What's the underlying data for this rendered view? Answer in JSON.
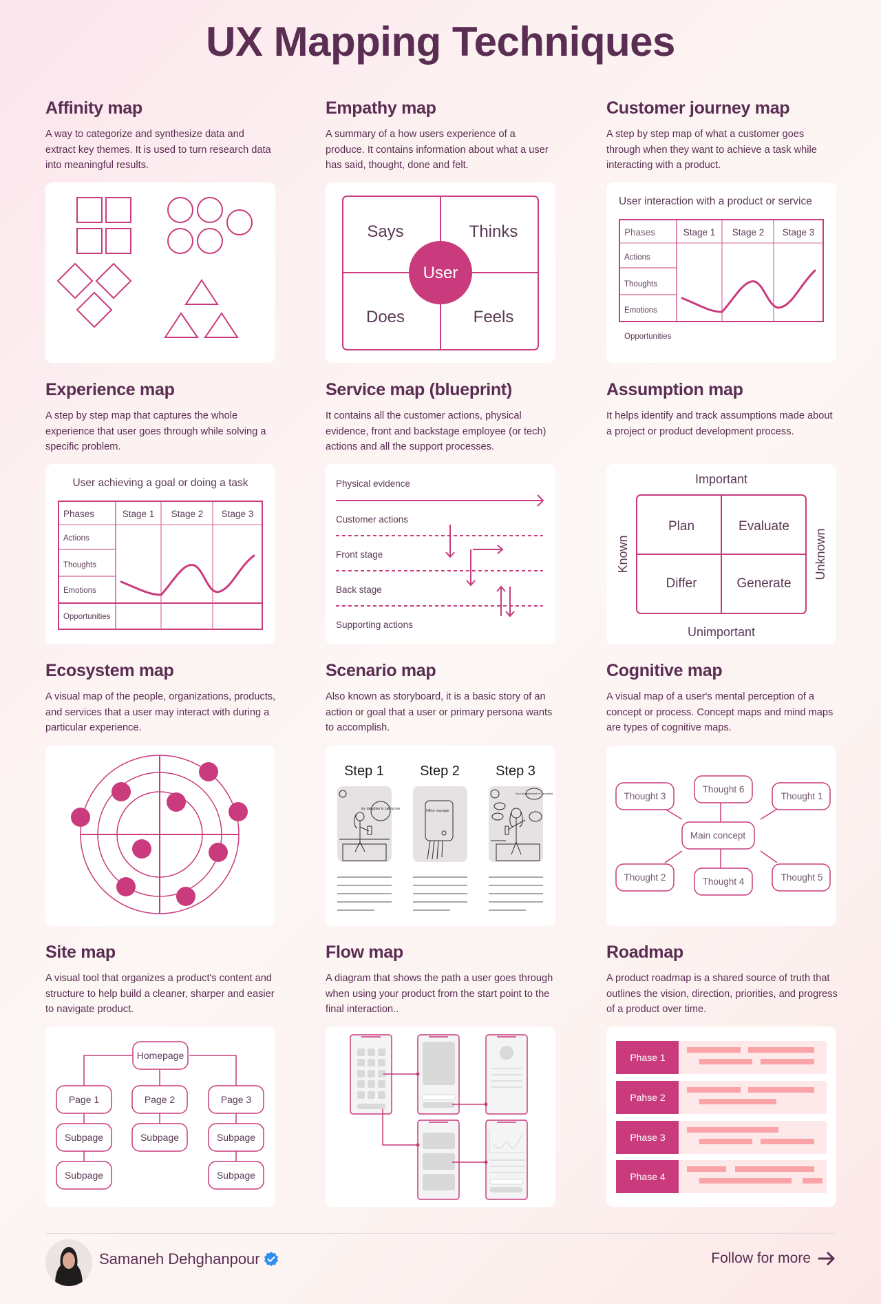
{
  "title": "UX Mapping Techniques",
  "colors": {
    "accent": "#c93b7c",
    "text": "#5a2d52",
    "panel": "#ffffff",
    "roadmap_bar": "#fba4a7",
    "roadmap_bg": "#fde9e9",
    "verified": "#2f8ff0"
  },
  "cards": [
    {
      "title": "Affinity map",
      "description": "A way to categorize and synthesize data and extract key themes. It is used to turn research data into meaningful results."
    },
    {
      "title": "Empathy map",
      "description": "A summary of a how users experience of a produce. It contains information about what a user has said, thought, done and felt.",
      "diagram": {
        "center": "User",
        "quadrants": [
          "Says",
          "Thinks",
          "Does",
          "Feels"
        ]
      }
    },
    {
      "title": "Customer journey map",
      "description": "A step by step map of what a customer goes through when they want to achieve a task while interacting with a product.",
      "diagram": {
        "heading": "User interaction with a product or service",
        "header_row": [
          "Phases",
          "Stage 1",
          "Stage 2",
          "Stage 3"
        ],
        "rows": [
          "Actions",
          "Thoughts",
          "Emotions",
          "Opportunities"
        ]
      }
    },
    {
      "title": "Experience map",
      "description": "A step by step map that captures the whole experience that user goes through while solving a specific problem.",
      "diagram": {
        "heading": "User achieving a goal or doing a task",
        "header_row": [
          "Phases",
          "Stage 1",
          "Stage 2",
          "Stage 3"
        ],
        "rows": [
          "Actions",
          "Thoughts",
          "Emotions",
          "Opportunities"
        ]
      }
    },
    {
      "title": "Service map (blueprint)",
      "description": "It contains all the customer actions, physical evidence, front and backstage employee (or tech) actions and all the support processes.",
      "diagram": {
        "lanes": [
          "Physical evidence",
          "Customer actions",
          "Front stage",
          "Back stage",
          "Supporting actions"
        ]
      }
    },
    {
      "title": "Assumption map",
      "description": "It helps identify and track assumptions made about a project or product development process.",
      "diagram": {
        "top": "Important",
        "bottom": "Unimportant",
        "left": "Known",
        "right": "Unknown",
        "quadrants": [
          "Plan",
          "Evaluate",
          "Differ",
          "Generate"
        ]
      }
    },
    {
      "title": "Ecosystem map",
      "description": "A visual map of the people, organizations, products, and services that a user may interact with during a particular experience."
    },
    {
      "title": "Scenario map",
      "description": "Also known as storyboard, it is a basic story of an action or goal that a user or primary persona wants to accomplish.",
      "diagram": {
        "steps": [
          "Step 1",
          "Step 2",
          "Step 3"
        ],
        "sketch_notes": [
          "my daughter is calling me",
          "Office manager",
          "Your Appointment is Cancelled"
        ]
      }
    },
    {
      "title": "Cognitive map",
      "description": "A visual map of a user's mental perception of a concept or process. Concept maps and mind maps are types of cognitive maps.",
      "diagram": {
        "center": "Main concept",
        "nodes": [
          "Thought 3",
          "Thought 6",
          "Thought 1",
          "Thought 2",
          "Thought 4",
          "Thought 5"
        ]
      }
    },
    {
      "title": "Site map",
      "description": "A visual tool that organizes a product's content and structure to help build a cleaner, sharper and easier to navigate product.",
      "diagram": {
        "root": "Homepage",
        "pages": [
          "Page 1",
          "Page 2",
          "Page 3"
        ],
        "subpage": "Subpage"
      }
    },
    {
      "title": "Flow map",
      "description": "A diagram that shows the path a user goes through when using your product from the start point to the final interaction.."
    },
    {
      "title": "Roadmap",
      "description": "A product roadmap is a shared source of truth that outlines the vision, direction, priorities, and progress of a product over time.",
      "diagram": {
        "phases": [
          "Phase 1",
          "Pahse 2",
          "Phase 3",
          "Phase 4"
        ]
      }
    }
  ],
  "footer": {
    "author": "Samaneh Dehghanpour",
    "verified_icon": "verified-badge-icon",
    "follow_label": "Follow for more",
    "follow_icon": "arrow-right-icon"
  }
}
